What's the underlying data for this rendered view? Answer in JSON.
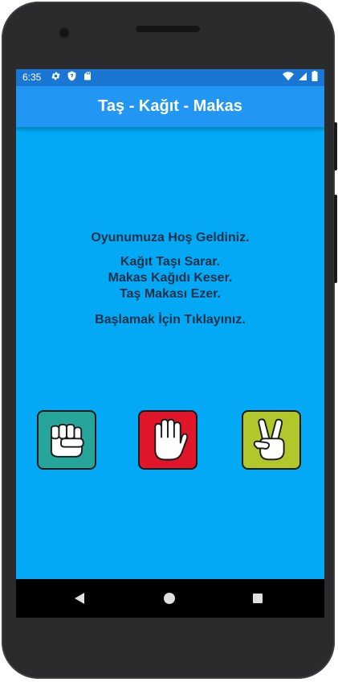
{
  "status_bar": {
    "time": "6:35",
    "icons": [
      "gear-icon",
      "shield-icon",
      "sd-card-icon",
      "wifi-icon",
      "signal-icon",
      "battery-icon"
    ]
  },
  "app_bar": {
    "title": "Taş - Kağıt - Makas"
  },
  "main": {
    "welcome": "Oyunumuza Hoş Geldiniz.",
    "rules": [
      "Kağıt Taşı Sarar.",
      "Makas Kağıdı Keser.",
      "Taş Makası Ezer."
    ],
    "prompt": "Başlamak İçin Tıklayınız."
  },
  "choices": [
    {
      "name": "rock",
      "icon": "rock-fist-icon",
      "color": "#26a69a"
    },
    {
      "name": "paper",
      "icon": "paper-hand-icon",
      "color": "#e0162b"
    },
    {
      "name": "scissors",
      "icon": "scissors-hand-icon",
      "color": "#b2c72c"
    }
  ],
  "nav_bar": {
    "icons": [
      "back-icon",
      "home-icon",
      "recents-icon"
    ]
  },
  "colors": {
    "background": "#03a9f4",
    "app_bar": "#2196f3",
    "status_bar": "#1976d2",
    "text": "#13314a"
  }
}
